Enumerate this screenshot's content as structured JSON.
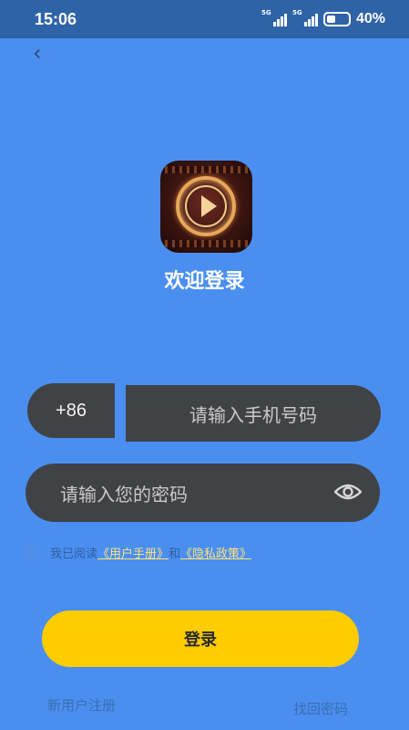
{
  "status_bar": {
    "time": "15:06",
    "network_1": "5G",
    "network_2": "5G",
    "battery": "40%"
  },
  "nav": {
    "back_glyph": "‹"
  },
  "header": {
    "title": "欢迎登录"
  },
  "form": {
    "country_code": "+86",
    "phone_placeholder": "请输入手机号码",
    "password_placeholder": "请输入您的密码",
    "agreement_prefix": "我已阅读",
    "user_manual_link": "《用户手册》",
    "agreement_and": "和",
    "privacy_link": "《隐私政策》",
    "login_button": "登录"
  },
  "footer": {
    "register": "新用户注册",
    "forgot_password": "找回密码"
  },
  "colors": {
    "background": "#4a8ff0",
    "status_bar": "#2f63a8",
    "input": "#404246",
    "login_button": "#ffcc00",
    "link": "#ffe07a"
  },
  "icons": [
    "app-logo-icon",
    "back-icon",
    "eye-icon",
    "radio-icon",
    "battery-icon",
    "signal-icon"
  ]
}
